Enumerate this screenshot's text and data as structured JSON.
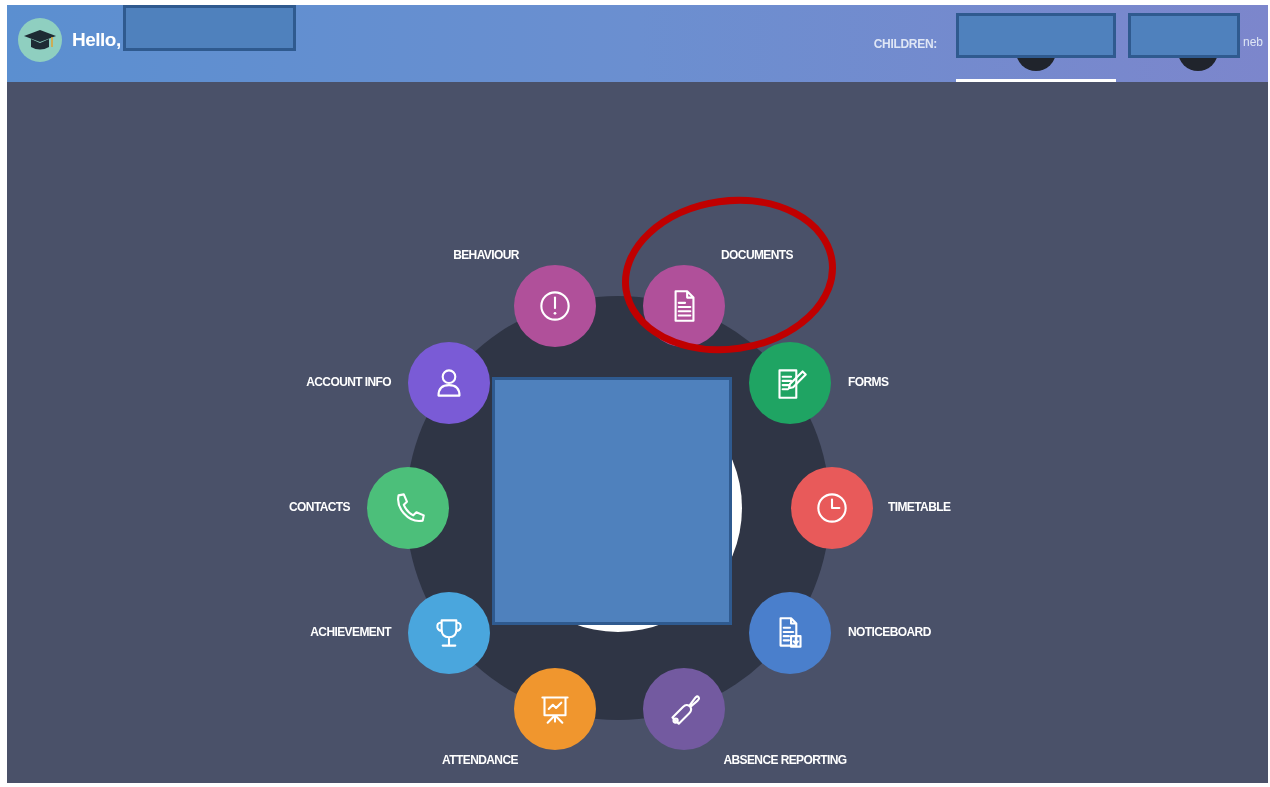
{
  "header": {
    "greeting": "Hello,",
    "children_label": "CHILDREN:",
    "children": [
      {
        "selected": true
      },
      {
        "name": "neb",
        "selected": false
      }
    ]
  },
  "menu": {
    "items": [
      {
        "label": "BEHAVIOUR",
        "kind": "alert",
        "color": "#b0509a",
        "highlighted": false
      },
      {
        "label": "DOCUMENTS",
        "kind": "document",
        "color": "#b0509a",
        "highlighted": true
      },
      {
        "label": "ACCOUNT INFO",
        "kind": "person",
        "color": "#7a5bd6",
        "highlighted": false
      },
      {
        "label": "FORMS",
        "kind": "form",
        "color": "#1fa463",
        "highlighted": false
      },
      {
        "label": "CONTACTS",
        "kind": "phone",
        "color": "#4cbf7a",
        "highlighted": false
      },
      {
        "label": "TIMETABLE",
        "kind": "clock",
        "color": "#e85a5a",
        "highlighted": false
      },
      {
        "label": "ACHIEVEMENT",
        "kind": "trophy",
        "color": "#4aa6dd",
        "highlighted": false
      },
      {
        "label": "NOTICEBOARD",
        "kind": "notice",
        "color": "#4a7fcc",
        "highlighted": false
      },
      {
        "label": "ATTENDANCE",
        "kind": "chart",
        "color": "#f0962e",
        "highlighted": false
      },
      {
        "label": "ABSENCE REPORTING",
        "kind": "bell",
        "color": "#735aa0",
        "highlighted": false
      }
    ]
  }
}
